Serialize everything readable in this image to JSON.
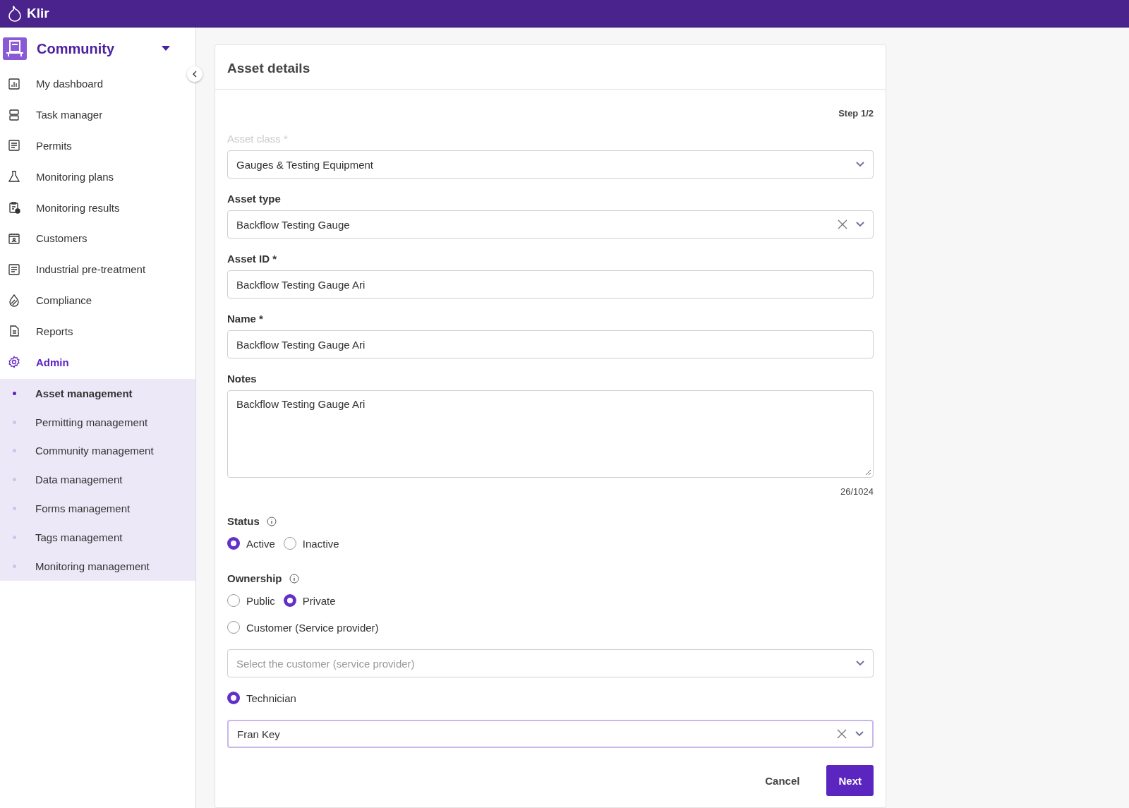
{
  "app": {
    "name": "Klir"
  },
  "sidebar": {
    "workspace": "Community",
    "items": [
      {
        "label": "My dashboard",
        "selected": false
      },
      {
        "label": "Task manager",
        "selected": false
      },
      {
        "label": "Permits",
        "selected": false
      },
      {
        "label": "Monitoring plans",
        "selected": false
      },
      {
        "label": "Monitoring results",
        "selected": false
      },
      {
        "label": "Customers",
        "selected": false
      },
      {
        "label": "Industrial pre-treatment",
        "selected": false
      },
      {
        "label": "Compliance",
        "selected": false
      },
      {
        "label": "Reports",
        "selected": false
      },
      {
        "label": "Admin",
        "selected": true,
        "children": [
          {
            "label": "Asset management",
            "selected": true
          },
          {
            "label": "Permitting management",
            "selected": false
          },
          {
            "label": "Community management",
            "selected": false
          },
          {
            "label": "Data management",
            "selected": false
          },
          {
            "label": "Forms management",
            "selected": false
          },
          {
            "label": "Tags management",
            "selected": false
          },
          {
            "label": "Monitoring management",
            "selected": false
          }
        ]
      }
    ]
  },
  "card": {
    "title": "Asset details",
    "step": "Step 1/2",
    "fields": [
      {
        "kind": "select",
        "label": "Asset class *",
        "value": "Gauges & Testing Equipment",
        "disabled": true,
        "clearable": false
      },
      {
        "kind": "select",
        "label": "Asset type",
        "value": "Backflow Testing Gauge",
        "disabled": false,
        "clearable": true
      },
      {
        "kind": "input",
        "label": "Asset ID *",
        "value": "Backflow Testing Gauge Ari",
        "disabled": false
      },
      {
        "kind": "input",
        "label": "Name *",
        "value": "Backflow Testing Gauge Ari",
        "disabled": false
      },
      {
        "kind": "textarea",
        "label": "Notes",
        "value": "Backflow Testing Gauge Ari",
        "counter": "26/1024",
        "disabled": false
      }
    ],
    "status": {
      "label": "Status",
      "options": [
        {
          "label": "Active",
          "selected": true
        },
        {
          "label": "Inactive",
          "selected": false
        }
      ]
    },
    "ownership": {
      "label": "Ownership",
      "rows": [
        {
          "kind": "radios",
          "options": [
            {
              "label": "Public",
              "selected": false
            },
            {
              "label": "Private",
              "selected": true
            }
          ]
        },
        {
          "kind": "radios",
          "options": [
            {
              "label": "Customer (Service provider)",
              "selected": false
            }
          ]
        },
        {
          "kind": "select",
          "placeholder": "Select the customer (service provider)",
          "clearable": false,
          "focused": false
        },
        {
          "kind": "radios",
          "options": [
            {
              "label": "Technician",
              "selected": true
            }
          ]
        },
        {
          "kind": "select",
          "value": "Fran Key",
          "clearable": true,
          "focused": true
        }
      ]
    },
    "buttons": [
      {
        "label": "Cancel",
        "kind": "secondary"
      },
      {
        "label": "Next",
        "kind": "primary"
      }
    ]
  }
}
